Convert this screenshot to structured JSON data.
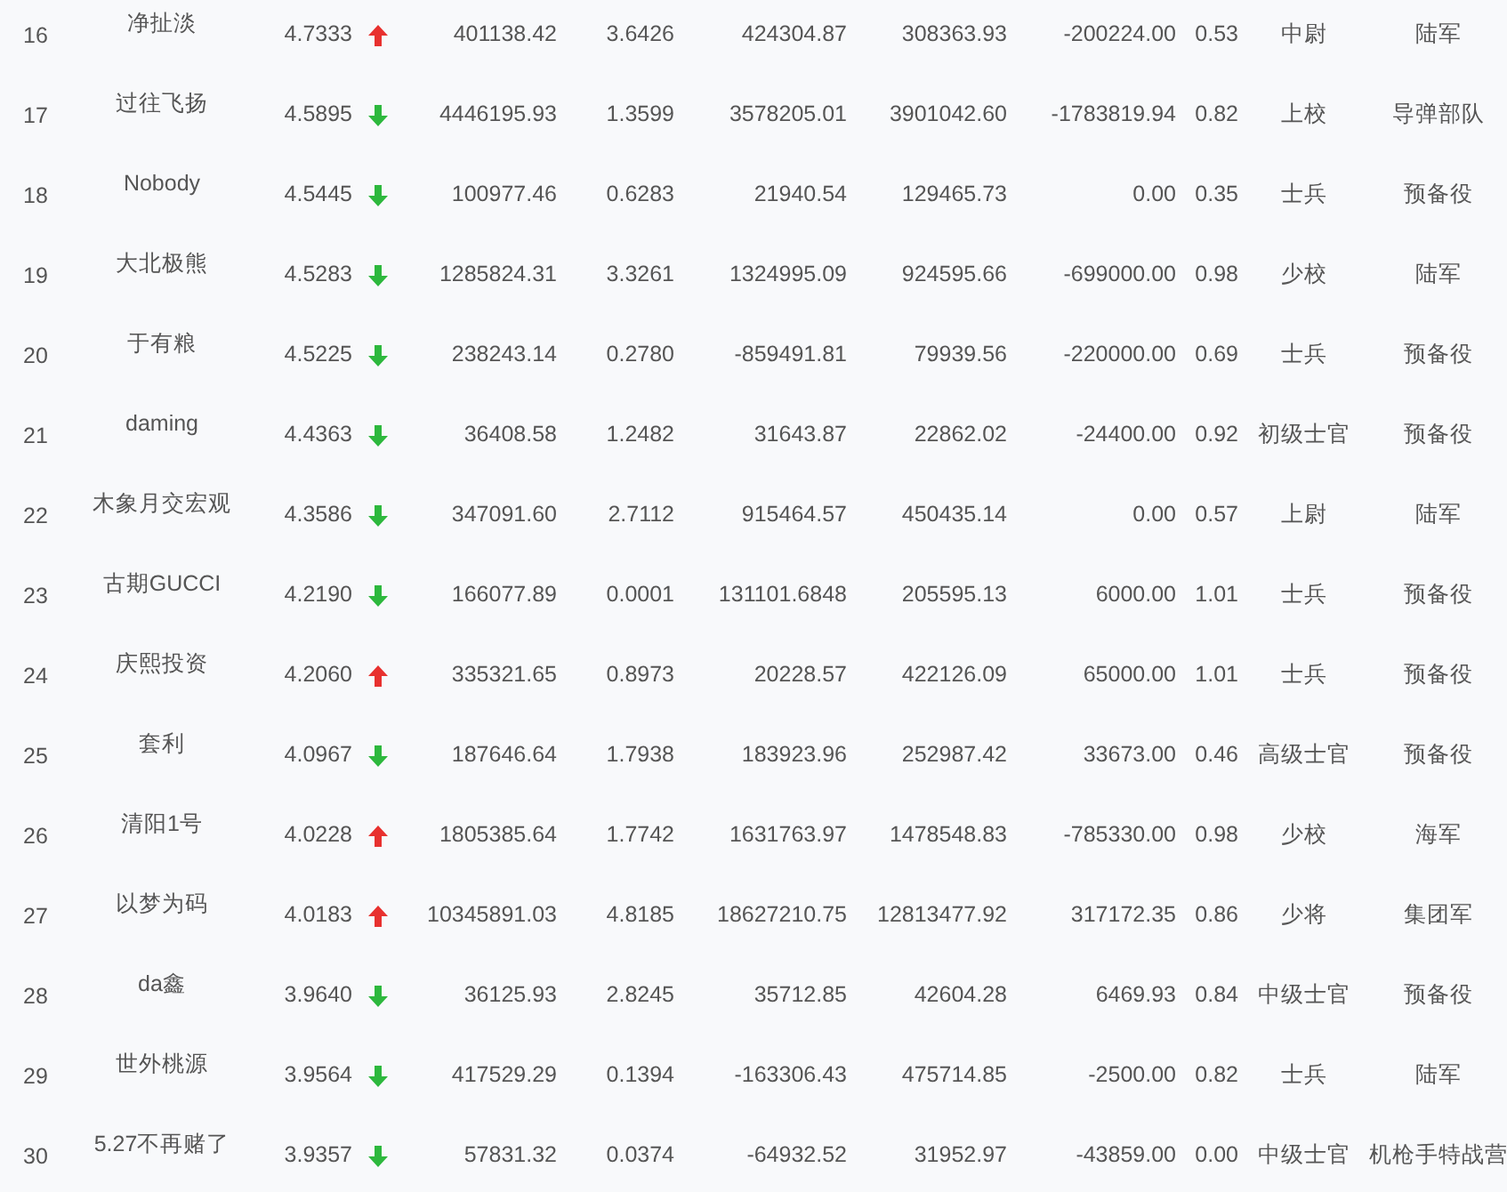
{
  "rows": [
    {
      "column_1": "16",
      "column_2": "净扯淡",
      "column_3": "4.7333",
      "rising": true,
      "column_4": "401138.42",
      "column_5": "3.6426",
      "column_6": "424304.87",
      "column_7": "308363.93",
      "column_8": "-200224.00",
      "column_9": "0.53",
      "column_10": "中尉",
      "column_11": "陆军"
    },
    {
      "column_1": "17",
      "column_2": "过往飞扬",
      "column_3": "4.5895",
      "rising": false,
      "column_4": "4446195.93",
      "column_5": "1.3599",
      "column_6": "3578205.01",
      "column_7": "3901042.60",
      "column_8": "-1783819.94",
      "column_9": "0.82",
      "column_10": "上校",
      "column_11": "导弹部队"
    },
    {
      "column_1": "18",
      "column_2": "Nobody",
      "column_3": "4.5445",
      "rising": false,
      "column_4": "100977.46",
      "column_5": "0.6283",
      "column_6": "21940.54",
      "column_7": "129465.73",
      "column_8": "0.00",
      "column_9": "0.35",
      "column_10": "士兵",
      "column_11": "预备役"
    },
    {
      "column_1": "19",
      "column_2": "大北极熊",
      "column_3": "4.5283",
      "rising": false,
      "column_4": "1285824.31",
      "column_5": "3.3261",
      "column_6": "1324995.09",
      "column_7": "924595.66",
      "column_8": "-699000.00",
      "column_9": "0.98",
      "column_10": "少校",
      "column_11": "陆军"
    },
    {
      "column_1": "20",
      "column_2": "于有粮",
      "column_3": "4.5225",
      "rising": false,
      "column_4": "238243.14",
      "column_5": "0.2780",
      "column_6": "-859491.81",
      "column_7": "79939.56",
      "column_8": "-220000.00",
      "column_9": "0.69",
      "column_10": "士兵",
      "column_11": "预备役"
    },
    {
      "column_1": "21",
      "column_2": "daming",
      "column_3": "4.4363",
      "rising": false,
      "column_4": "36408.58",
      "column_5": "1.2482",
      "column_6": "31643.87",
      "column_7": "22862.02",
      "column_8": "-24400.00",
      "column_9": "0.92",
      "column_10": "初级士官",
      "column_11": "预备役"
    },
    {
      "column_1": "22",
      "column_2": "木象月交宏观",
      "column_3": "4.3586",
      "rising": false,
      "column_4": "347091.60",
      "column_5": "2.7112",
      "column_6": "915464.57",
      "column_7": "450435.14",
      "column_8": "0.00",
      "column_9": "0.57",
      "column_10": "上尉",
      "column_11": "陆军"
    },
    {
      "column_1": "23",
      "column_2": "古期GUCCI",
      "column_3": "4.2190",
      "rising": false,
      "column_4": "166077.89",
      "column_5": "0.0001",
      "column_6": "131101.6848",
      "column_7": "205595.13",
      "column_8": "6000.00",
      "column_9": "1.01",
      "column_10": "士兵",
      "column_11": "预备役"
    },
    {
      "column_1": "24",
      "column_2": "庆熙投资",
      "column_3": "4.2060",
      "rising": true,
      "column_4": "335321.65",
      "column_5": "0.8973",
      "column_6": "20228.57",
      "column_7": "422126.09",
      "column_8": "65000.00",
      "column_9": "1.01",
      "column_10": "士兵",
      "column_11": "预备役"
    },
    {
      "column_1": "25",
      "column_2": "套利",
      "column_3": "4.0967",
      "rising": false,
      "column_4": "187646.64",
      "column_5": "1.7938",
      "column_6": "183923.96",
      "column_7": "252987.42",
      "column_8": "33673.00",
      "column_9": "0.46",
      "column_10": "高级士官",
      "column_11": "预备役"
    },
    {
      "column_1": "26",
      "column_2": "清阳1号",
      "column_3": "4.0228",
      "rising": true,
      "column_4": "1805385.64",
      "column_5": "1.7742",
      "column_6": "1631763.97",
      "column_7": "1478548.83",
      "column_8": "-785330.00",
      "column_9": "0.98",
      "column_10": "少校",
      "column_11": "海军"
    },
    {
      "column_1": "27",
      "column_2": "以梦为码",
      "column_3": "4.0183",
      "rising": true,
      "column_4": "10345891.03",
      "column_5": "4.8185",
      "column_6": "18627210.75",
      "column_7": "12813477.92",
      "column_8": "317172.35",
      "column_9": "0.86",
      "column_10": "少将",
      "column_11": "集团军"
    },
    {
      "column_1": "28",
      "column_2": "da鑫",
      "column_3": "3.9640",
      "rising": false,
      "column_4": "36125.93",
      "column_5": "2.8245",
      "column_6": "35712.85",
      "column_7": "42604.28",
      "column_8": "6469.93",
      "column_9": "0.84",
      "column_10": "中级士官",
      "column_11": "预备役"
    },
    {
      "column_1": "29",
      "column_2": "世外桃源",
      "column_3": "3.9564",
      "rising": false,
      "column_4": "417529.29",
      "column_5": "0.1394",
      "column_6": "-163306.43",
      "column_7": "475714.85",
      "column_8": "-2500.00",
      "column_9": "0.82",
      "column_10": "士兵",
      "column_11": "陆军"
    },
    {
      "column_1": "30",
      "column_2": "5.27不再赌了",
      "column_3": "3.9357",
      "rising": false,
      "column_4": "57831.32",
      "column_5": "0.0374",
      "column_6": "-64932.52",
      "column_7": "31952.97",
      "column_8": "-43859.00",
      "column_9": "0.00",
      "column_10": "中级士官",
      "column_11": "机枪手特战营"
    }
  ]
}
